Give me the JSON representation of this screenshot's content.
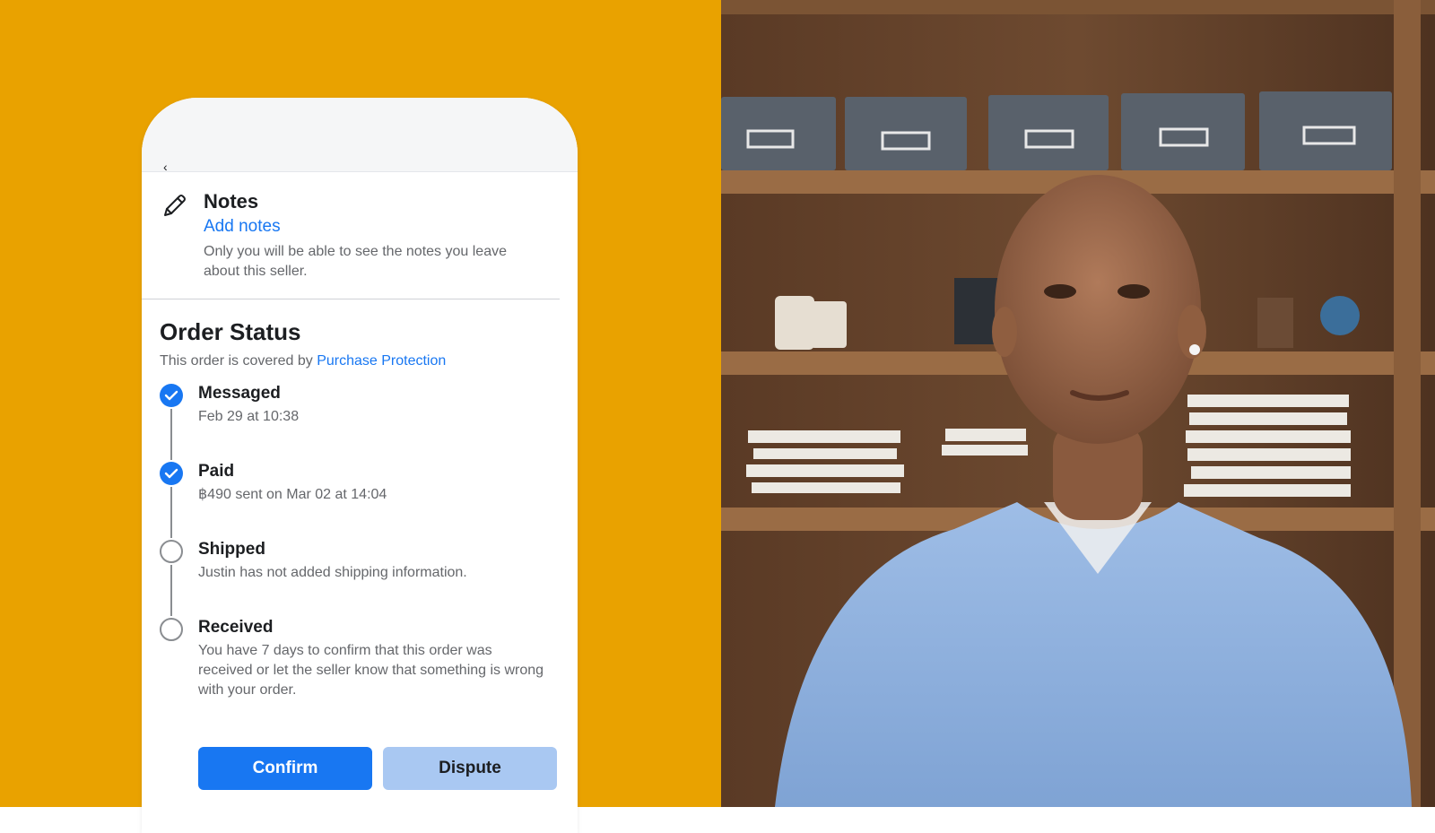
{
  "colors": {
    "background": "#E9A200",
    "accent": "#1877F2",
    "dispute_button": "#A9C8F2"
  },
  "notes": {
    "icon": "pencil-icon",
    "title": "Notes",
    "link": "Add notes",
    "description": "Only you will be able to see the notes you leave about this seller."
  },
  "order_status": {
    "title": "Order Status",
    "coverage_prefix": "This order is covered by",
    "coverage_link": "Purchase Protection",
    "steps": [
      {
        "title": "Messaged",
        "desc": "Feb 29 at 10:38",
        "state": "done"
      },
      {
        "title": "Paid",
        "desc": "฿490 sent on Mar 02 at 14:04",
        "state": "done"
      },
      {
        "title": "Shipped",
        "desc": "Justin has not added shipping information.",
        "state": "pending"
      },
      {
        "title": "Received",
        "desc": "You have 7 days to confirm that this order was received or let the seller know that something is wrong with your order.",
        "state": "pending"
      }
    ]
  },
  "actions": {
    "confirm": "Confirm",
    "dispute": "Dispute"
  }
}
